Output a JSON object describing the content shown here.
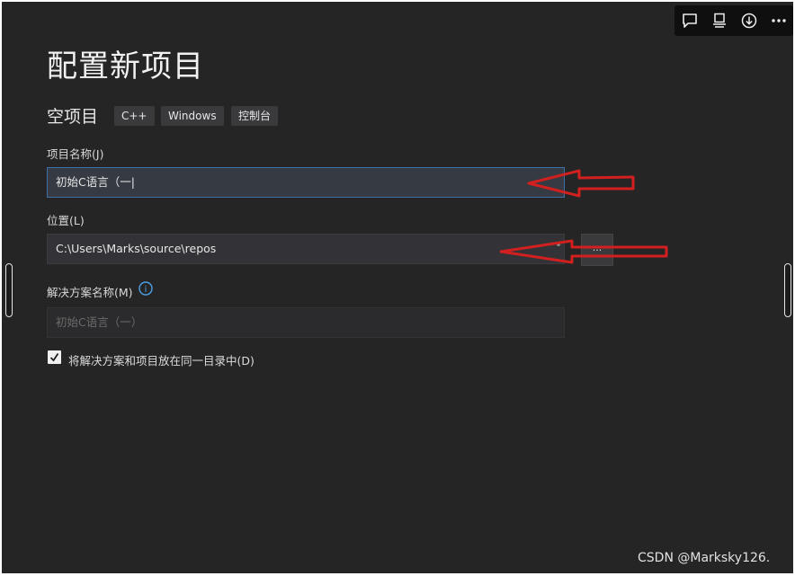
{
  "toolbar": {
    "icons": [
      "comment-icon",
      "board-icon",
      "download-icon",
      "more-icon"
    ]
  },
  "page": {
    "title": "配置新项目",
    "template_name": "空项目",
    "tags": [
      "C++",
      "Windows",
      "控制台"
    ]
  },
  "form": {
    "project_name": {
      "label": "项目名称(J)",
      "value": "初始C语言（一|"
    },
    "location": {
      "label": "位置(L)",
      "value": "C:\\Users\\Marks\\source\\repos",
      "browse_label": "..."
    },
    "solution_name": {
      "label": "解决方案名称(M)",
      "placeholder": "初始C语言（一）",
      "info_icon": "i"
    },
    "same_directory": {
      "label": "将解决方案和项目放在同一目录中(D)",
      "checked": true
    }
  },
  "watermark": "CSDN @Marksky126.",
  "colors": {
    "background": "#252526",
    "annotation_arrow": "#d21f1f",
    "focus_border": "#3f6fa8"
  }
}
